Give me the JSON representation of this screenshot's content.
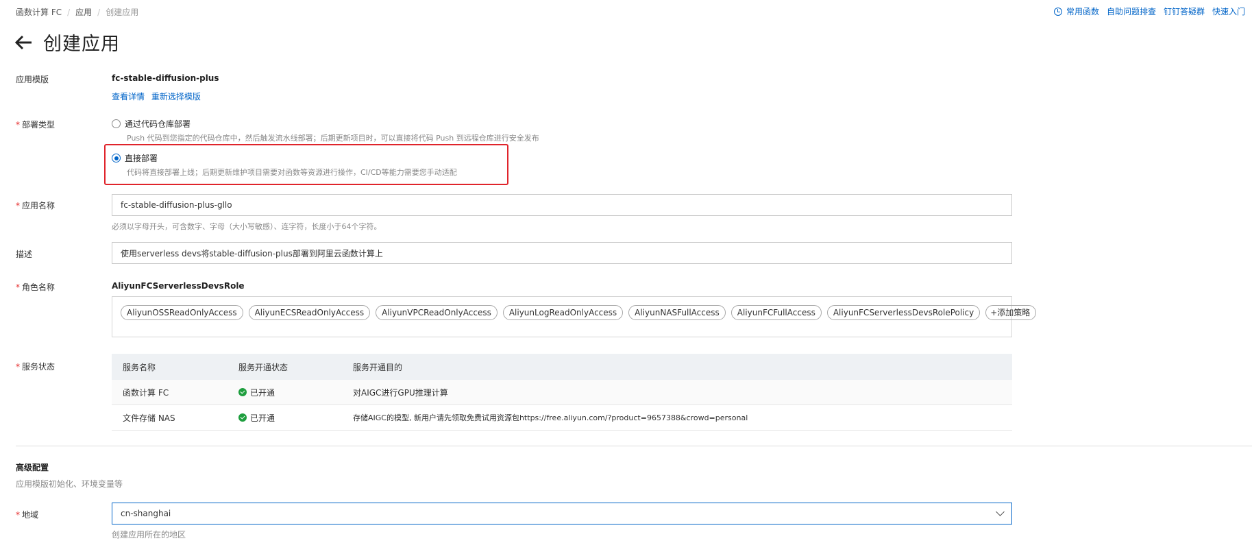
{
  "breadcrumb": [
    "函数计算 FC",
    "应用",
    "创建应用"
  ],
  "top_links": [
    "常用函数",
    "自助问题排查",
    "钉钉答疑群",
    "快速入门"
  ],
  "page_title": "创建应用",
  "template": {
    "label": "应用模版",
    "name": "fc-stable-diffusion-plus",
    "view_details": "查看详情",
    "reselect": "重新选择模版"
  },
  "deploy_type": {
    "label": "部署类型",
    "options": [
      {
        "title": "通过代码仓库部署",
        "desc": "Push 代码到您指定的代码仓库中，然后触发流水线部署；后期更新项目时，可以直接将代码 Push 到远程仓库进行安全发布",
        "checked": false
      },
      {
        "title": "直接部署",
        "desc": "代码将直接部署上线；后期更新维护项目需要对函数等资源进行操作，CI/CD等能力需要您手动适配",
        "checked": true
      }
    ]
  },
  "app_name": {
    "label": "应用名称",
    "value": "fc-stable-diffusion-plus-gllo",
    "hint": "必须以字母开头，可含数字、字母（大小写敏感）、连字符，长度小于64个字符。"
  },
  "description": {
    "label": "描述",
    "value": "使用serverless devs将stable-diffusion-plus部署到阿里云函数计算上"
  },
  "role": {
    "label": "角色名称",
    "name": "AliyunFCServerlessDevsRole",
    "policies": [
      "AliyunOSSReadOnlyAccess",
      "AliyunECSReadOnlyAccess",
      "AliyunVPCReadOnlyAccess",
      "AliyunLogReadOnlyAccess",
      "AliyunNASFullAccess",
      "AliyunFCFullAccess",
      "AliyunFCServerlessDevsRolePolicy"
    ],
    "add_policy": "+添加策略"
  },
  "service_status": {
    "label": "服务状态",
    "headers": [
      "服务名称",
      "服务开通状态",
      "服务开通目的"
    ],
    "rows": [
      {
        "name": "函数计算 FC",
        "status": "已开通",
        "purpose": "对AIGC进行GPU推理计算"
      },
      {
        "name": "文件存储 NAS",
        "status": "已开通",
        "purpose": "存储AIGC的模型, 新用户请先领取免费试用资源包https://free.aliyun.com/?product=9657388&crowd=personal"
      }
    ]
  },
  "advanced": {
    "title": "高级配置",
    "subtitle": "应用模版初始化、环境变量等"
  },
  "region": {
    "label": "地域",
    "value": "cn-shanghai",
    "hint": "创建应用所在的地区"
  },
  "colors": {
    "accent": "#0064c8",
    "required": "#e62e2e",
    "highlight_box": "#e0242b",
    "success": "#1e9e3e"
  }
}
